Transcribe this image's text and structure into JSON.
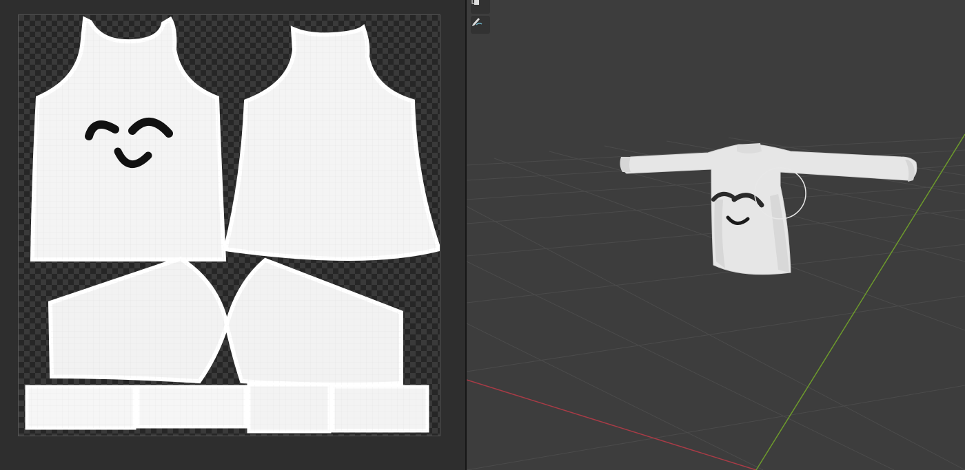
{
  "uv_editor": {
    "name": "uv-editor",
    "islands": [
      "front-body",
      "back-body",
      "left-sleeve",
      "right-sleeve",
      "cuff-1",
      "cuff-2",
      "cuff-3",
      "cuff-4"
    ]
  },
  "viewport": {
    "tools": [
      {
        "id": "copy-tool",
        "icon": "copy-icon"
      },
      {
        "id": "draw-tool",
        "icon": "brush-icon"
      }
    ],
    "colors": {
      "background": "#3d3d3d",
      "grid": "#4a4a4a",
      "x_axis": "#a83b46",
      "y_axis": "#6d9a2c",
      "mesh": "#e8e8e8",
      "paint": "#1a1a1a"
    }
  }
}
